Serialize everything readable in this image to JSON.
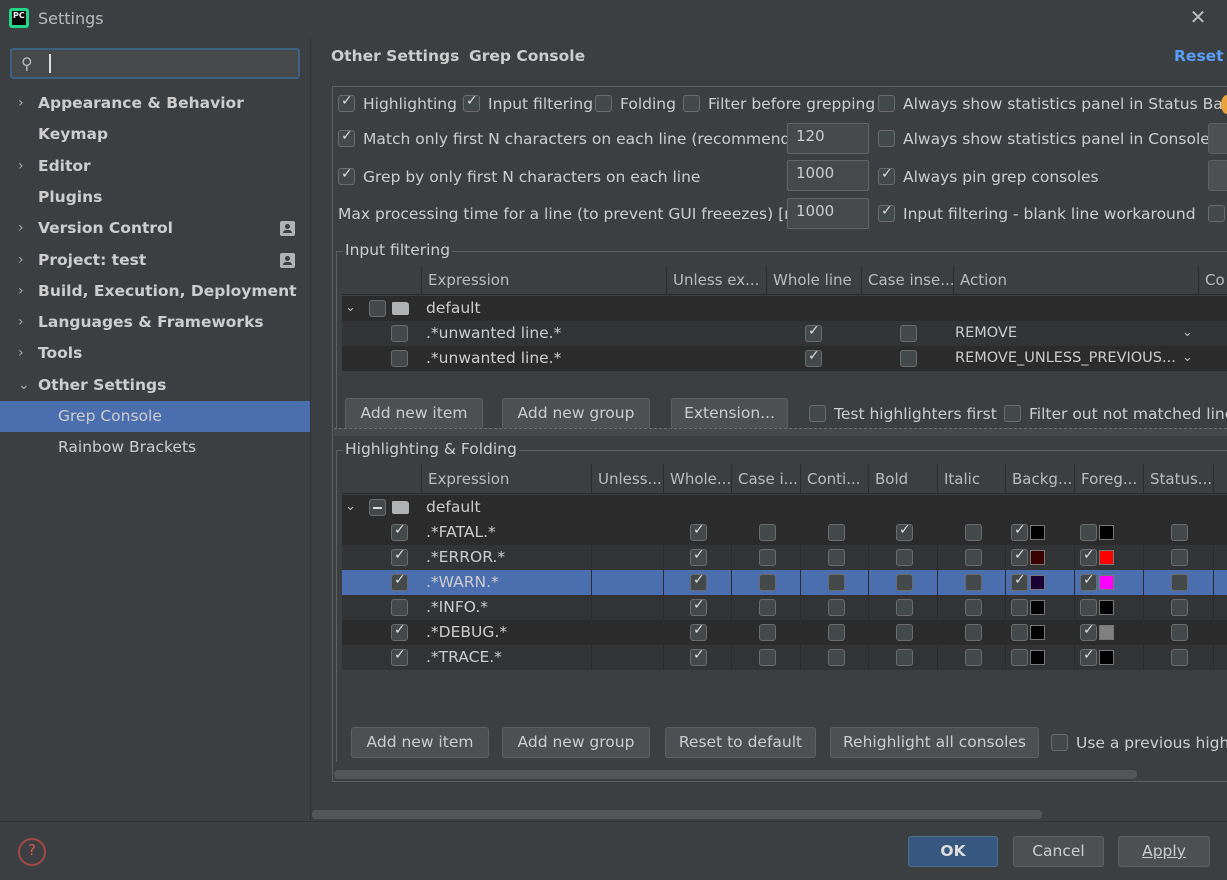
{
  "window": {
    "title": "Settings",
    "app_icon_text": "PC"
  },
  "search": {
    "placeholder": ""
  },
  "sidebar": {
    "items": [
      {
        "label": "Appearance & Behavior",
        "expandable": true,
        "badge": false
      },
      {
        "label": "Keymap",
        "expandable": false,
        "badge": false
      },
      {
        "label": "Editor",
        "expandable": true,
        "badge": false
      },
      {
        "label": "Plugins",
        "expandable": false,
        "badge": false
      },
      {
        "label": "Version Control",
        "expandable": true,
        "badge": true
      },
      {
        "label": "Project: test",
        "expandable": true,
        "badge": true
      },
      {
        "label": "Build, Execution, Deployment",
        "expandable": true,
        "badge": false
      },
      {
        "label": "Languages & Frameworks",
        "expandable": true,
        "badge": false
      },
      {
        "label": "Tools",
        "expandable": true,
        "badge": false
      },
      {
        "label": "Other Settings",
        "expandable": true,
        "expanded": true,
        "badge": false
      },
      {
        "label": "Grep Console",
        "sub": true,
        "selected": true
      },
      {
        "label": "Rainbow Brackets",
        "sub": true
      }
    ]
  },
  "breadcrumb": {
    "parent": "Other Settings",
    "separator": "›",
    "current": "Grep Console"
  },
  "header": {
    "reset_label": "Reset"
  },
  "options": {
    "highlighting": {
      "label": "Highlighting",
      "checked": true
    },
    "input_filtering": {
      "label": "Input filtering",
      "checked": true
    },
    "folding": {
      "label": "Folding",
      "checked": false
    },
    "filter_before_grepping": {
      "label": "Filter before grepping",
      "checked": false
    },
    "always_show_stats_status_bar": {
      "label": "Always show statistics panel in Status Bar",
      "checked": false
    },
    "match_first_n": {
      "label": "Match only first N characters on each line (recommended)",
      "checked": true,
      "value": "120"
    },
    "always_show_stats_console": {
      "label": "Always show statistics panel in Console",
      "checked": false
    },
    "grep_first_n": {
      "label": "Grep by only first N characters on each line",
      "checked": true,
      "value": "1000"
    },
    "always_pin": {
      "label": "Always pin grep consoles",
      "checked": true
    },
    "max_processing": {
      "label": "Max processing time for a line (to prevent GUI freeezes) [ms]",
      "value": "1000"
    },
    "blank_line_workaround": {
      "label": "Input filtering - blank line workaround",
      "checked": true
    }
  },
  "input_filtering": {
    "title": "Input filtering",
    "columns": [
      "Expression",
      "Unless ex...",
      "Whole line",
      "Case inse...",
      "Action",
      "Co"
    ],
    "group": "default",
    "rows": [
      {
        "checked": false,
        "expression": ".*unwanted line.*",
        "whole_line": true,
        "case_insensitive": false,
        "action": "REMOVE"
      },
      {
        "checked": false,
        "expression": ".*unwanted line.*",
        "whole_line": true,
        "case_insensitive": false,
        "action": "REMOVE_UNLESS_PREVIOUS..."
      }
    ],
    "buttons": {
      "add_item": "Add new item",
      "add_group": "Add new group",
      "extension": "Extension..."
    },
    "test_highlighters_first": {
      "label": "Test highlighters first",
      "checked": false
    },
    "filter_out_not_matched": {
      "label": "Filter out not matched lines",
      "checked": false
    }
  },
  "highlighting": {
    "title": "Highlighting & Folding",
    "columns": [
      "Expression",
      "Unless...",
      "Whole...",
      "Case i...",
      "Conti...",
      "Bold",
      "Italic",
      "Backg...",
      "Foreg...",
      "Status..."
    ],
    "group": "default",
    "rows": [
      {
        "checked": true,
        "expression": ".*FATAL.*",
        "whole": true,
        "case": false,
        "conti": false,
        "bold": true,
        "italic": false,
        "bg_on": true,
        "bg": "#000000",
        "fg_on": false,
        "fg": "#000000",
        "status": false,
        "selected": false
      },
      {
        "checked": true,
        "expression": ".*ERROR.*",
        "whole": true,
        "case": false,
        "conti": false,
        "bold": false,
        "italic": false,
        "bg_on": true,
        "bg": "#3a0000",
        "fg_on": true,
        "fg": "#ff0000",
        "status": false,
        "selected": false
      },
      {
        "checked": true,
        "expression": ".*WARN.*",
        "whole": true,
        "case": false,
        "conti": false,
        "bold": false,
        "italic": false,
        "bg_on": true,
        "bg": "#1a0033",
        "fg_on": true,
        "fg": "#ff00ff",
        "status": false,
        "selected": true
      },
      {
        "checked": false,
        "expression": ".*INFO.*",
        "whole": true,
        "case": false,
        "conti": false,
        "bold": false,
        "italic": false,
        "bg_on": false,
        "bg": "#000000",
        "fg_on": false,
        "fg": "#000000",
        "status": false,
        "selected": false
      },
      {
        "checked": true,
        "expression": ".*DEBUG.*",
        "whole": true,
        "case": false,
        "conti": false,
        "bold": false,
        "italic": false,
        "bg_on": false,
        "bg": "#000000",
        "fg_on": true,
        "fg": "#808080",
        "status": false,
        "selected": false
      },
      {
        "checked": true,
        "expression": ".*TRACE.*",
        "whole": true,
        "case": false,
        "conti": false,
        "bold": false,
        "italic": false,
        "bg_on": false,
        "bg": "#000000",
        "fg_on": true,
        "fg": "#000000",
        "status": false,
        "selected": false
      }
    ],
    "buttons": {
      "add_item": "Add new item",
      "add_group": "Add new group",
      "reset_default": "Reset to default",
      "rehighlight": "Rehighlight all consoles"
    },
    "use_previous": {
      "label": "Use a previous highli",
      "checked": false
    }
  },
  "footer": {
    "ok": "OK",
    "cancel": "Cancel",
    "apply": "Apply"
  },
  "colors": {
    "accent": "#4b6eaf",
    "link": "#589df6"
  }
}
